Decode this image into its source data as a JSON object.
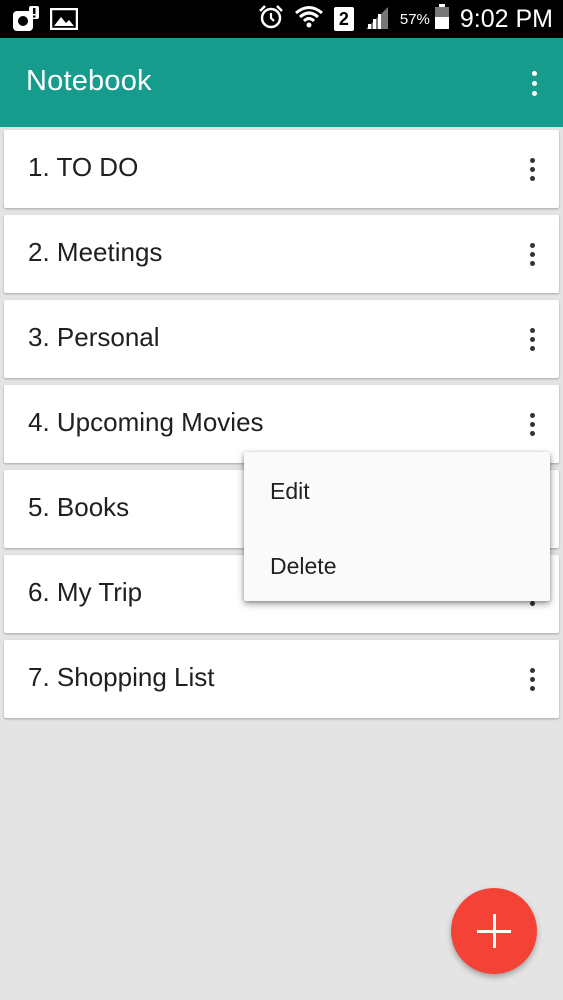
{
  "status_bar": {
    "time": "9:02 PM",
    "battery_percent": "57%",
    "sim_slot": "2",
    "icons": [
      "notification-icon",
      "image-icon",
      "alarm-icon",
      "wifi-icon",
      "sim-icon",
      "signal-icon",
      "battery-icon"
    ]
  },
  "app_bar": {
    "title": "Notebook",
    "background": "#169c8c"
  },
  "notebooks": [
    {
      "label": "1. TO DO"
    },
    {
      "label": "2. Meetings"
    },
    {
      "label": "3. Personal"
    },
    {
      "label": "4. Upcoming Movies"
    },
    {
      "label": "5. Books"
    },
    {
      "label": "6. My Trip"
    },
    {
      "label": "7. Shopping List"
    }
  ],
  "popup_menu": {
    "items": [
      "Edit",
      "Delete"
    ]
  },
  "fab": {
    "icon": "plus-icon",
    "color": "#f44336"
  }
}
